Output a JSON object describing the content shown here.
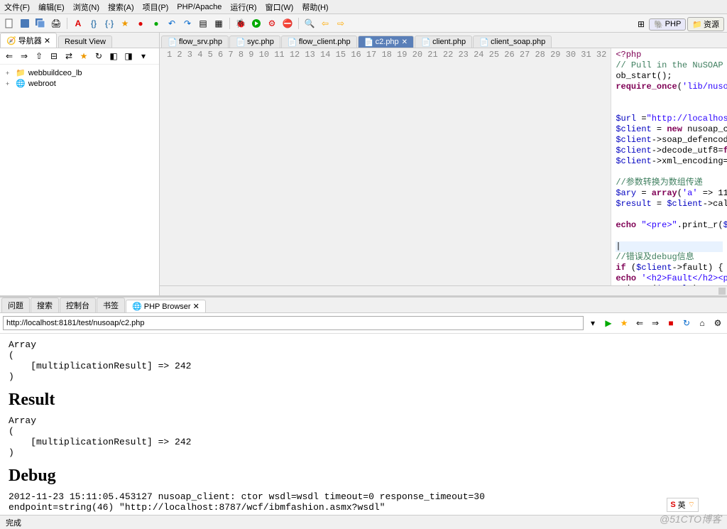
{
  "menu": [
    "文件(F)",
    "编辑(E)",
    "浏览(N)",
    "搜索(A)",
    "项目(P)",
    "PHP/Apache",
    "运行(R)",
    "窗口(W)",
    "帮助(H)"
  ],
  "perspective": {
    "php": "PHP",
    "res": "资源"
  },
  "sidebar": {
    "tabs": {
      "nav": "导航器",
      "result": "Result View"
    },
    "tree": [
      {
        "exp": "+",
        "icon": "folder",
        "label": "webbuildceo_lb"
      },
      {
        "exp": "+",
        "icon": "globe",
        "label": "webroot"
      }
    ]
  },
  "editor_tabs": [
    {
      "label": "flow_srv.php",
      "active": false
    },
    {
      "label": "syc.php",
      "active": false
    },
    {
      "label": "flow_client.php",
      "active": false
    },
    {
      "label": "c2.php",
      "active": true
    },
    {
      "label": "client.php",
      "active": false
    },
    {
      "label": "client_soap.php",
      "active": false
    }
  ],
  "code_lines": 32,
  "bottom_tabs": [
    "问题",
    "搜索",
    "控制台",
    "书签",
    "PHP Browser"
  ],
  "bottom_active": 4,
  "url": "http://localhost:8181/test/nusoap/c2.php",
  "browser_output": {
    "array1": "Array\n(\n    [multiplicationResult] => 242\n)",
    "h_result": "Result",
    "array2": "Array\n(\n    [multiplicationResult] => 242\n)",
    "h_debug": "Debug",
    "debug_text": "2012-11-23 15:11:05.453127 nusoap_client: ctor wsdl=wsdl timeout=0 response_timeout=30\nendpoint=string(46) \"http://localhost:8787/wcf/ibmfashion.asmx?wsdl\""
  },
  "status": "完成",
  "watermark": "@51CTO博客",
  "ime": "英"
}
